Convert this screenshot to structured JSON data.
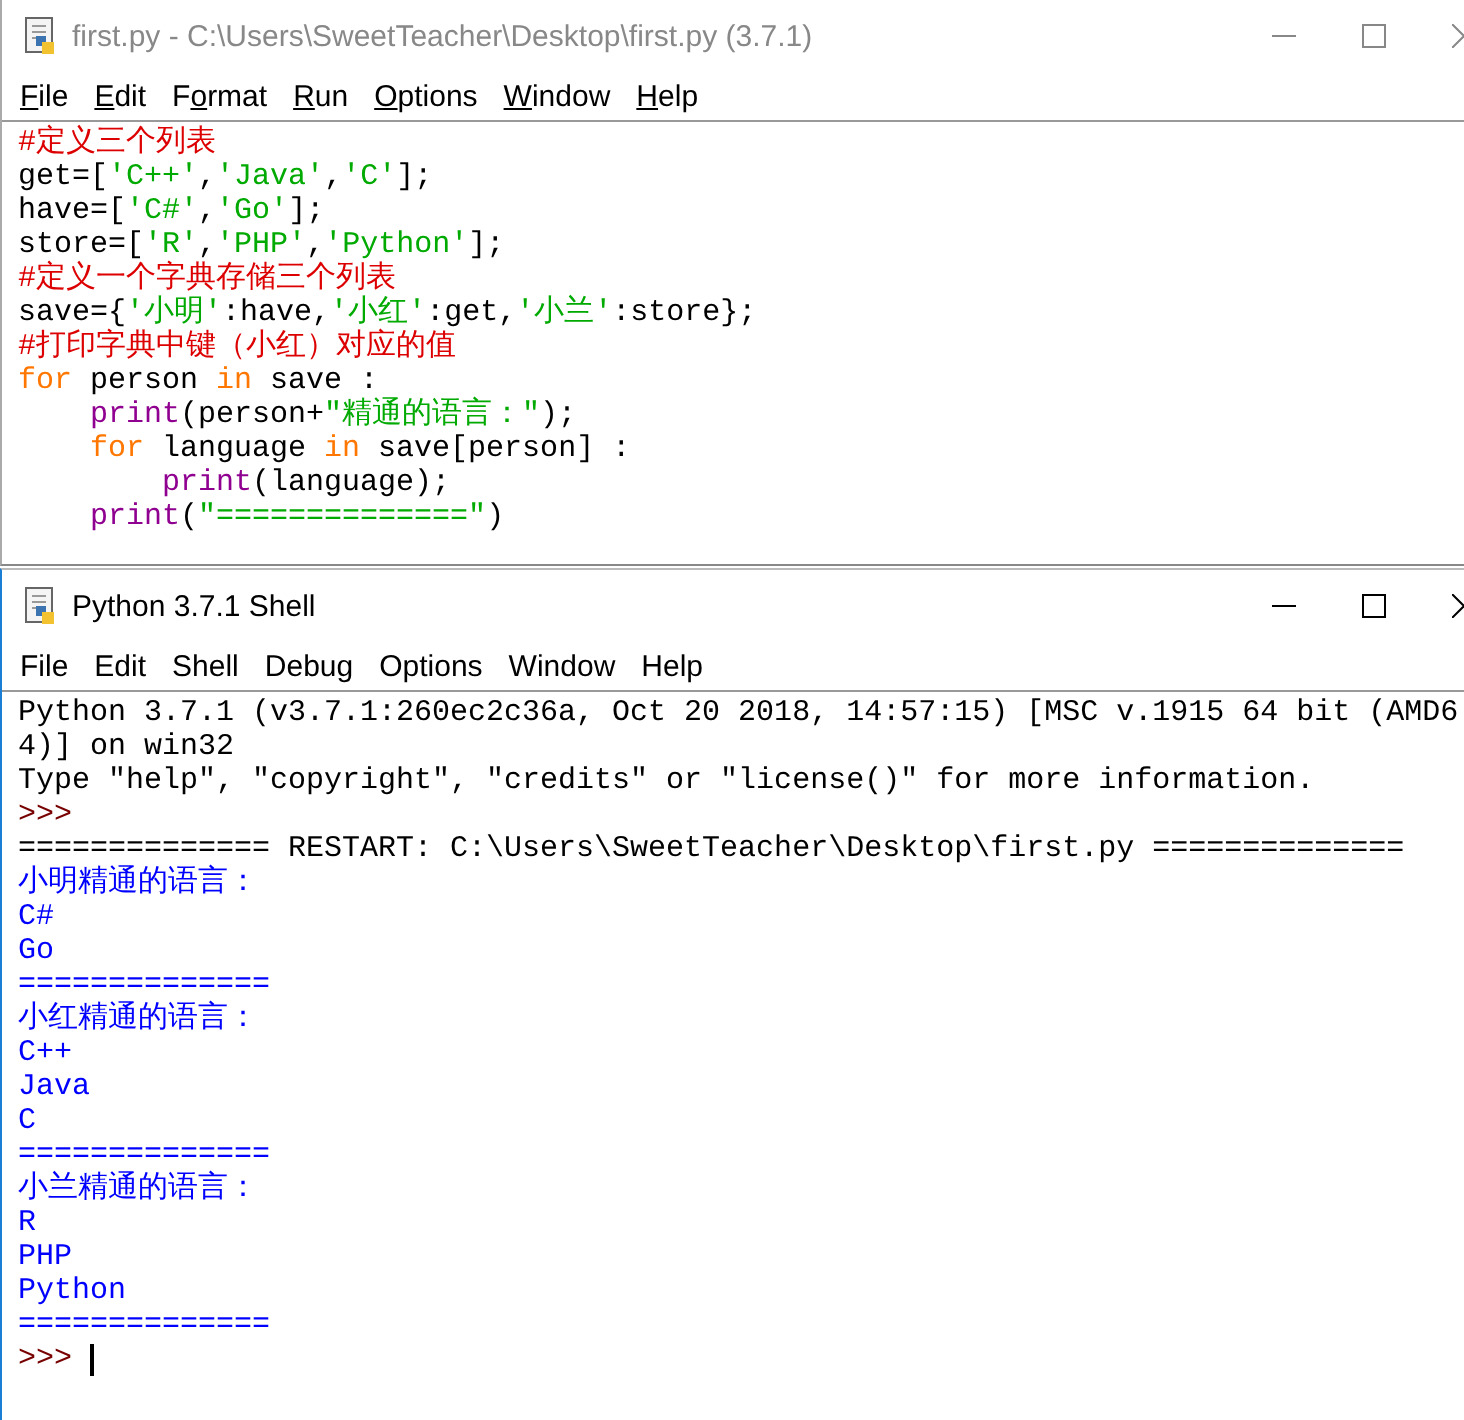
{
  "editor": {
    "title": "first.py - C:\\Users\\SweetTeacher\\Desktop\\first.py (3.7.1)",
    "active": false,
    "menu": [
      {
        "key": "F",
        "after": "ile"
      },
      {
        "key": "E",
        "after": "dit"
      },
      {
        "before": "F",
        "key": "o",
        "after": "rmat"
      },
      {
        "key": "R",
        "after": "un"
      },
      {
        "key": "O",
        "after": "ptions"
      },
      {
        "key": "W",
        "after": "indow"
      },
      {
        "key": "H",
        "after": "elp"
      }
    ],
    "lines": [
      [
        {
          "kind": "comment",
          "text": "#定义三个列表"
        }
      ],
      [
        {
          "kind": "plain",
          "text": "get=["
        },
        {
          "kind": "string",
          "text": "'C++'"
        },
        {
          "kind": "plain",
          "text": ","
        },
        {
          "kind": "string",
          "text": "'Java'"
        },
        {
          "kind": "plain",
          "text": ","
        },
        {
          "kind": "string",
          "text": "'C'"
        },
        {
          "kind": "plain",
          "text": "];"
        }
      ],
      [
        {
          "kind": "plain",
          "text": "have=["
        },
        {
          "kind": "string",
          "text": "'C#'"
        },
        {
          "kind": "plain",
          "text": ","
        },
        {
          "kind": "string",
          "text": "'Go'"
        },
        {
          "kind": "plain",
          "text": "];"
        }
      ],
      [
        {
          "kind": "plain",
          "text": "store=["
        },
        {
          "kind": "string",
          "text": "'R'"
        },
        {
          "kind": "plain",
          "text": ","
        },
        {
          "kind": "string",
          "text": "'PHP'"
        },
        {
          "kind": "plain",
          "text": ","
        },
        {
          "kind": "string",
          "text": "'Python'"
        },
        {
          "kind": "plain",
          "text": "];"
        }
      ],
      [
        {
          "kind": "comment",
          "text": "#定义一个字典存储三个列表"
        }
      ],
      [
        {
          "kind": "plain",
          "text": "save={"
        },
        {
          "kind": "string",
          "text": "'小明'"
        },
        {
          "kind": "plain",
          "text": ":have,"
        },
        {
          "kind": "string",
          "text": "'小红'"
        },
        {
          "kind": "plain",
          "text": ":get,"
        },
        {
          "kind": "string",
          "text": "'小兰'"
        },
        {
          "kind": "plain",
          "text": ":store};"
        }
      ],
      [
        {
          "kind": "comment",
          "text": "#打印字典中键（小红）对应的值"
        }
      ],
      [
        {
          "kind": "keyword",
          "text": "for"
        },
        {
          "kind": "plain",
          "text": " person "
        },
        {
          "kind": "keyword",
          "text": "in"
        },
        {
          "kind": "plain",
          "text": " save :"
        }
      ],
      [
        {
          "kind": "builtin",
          "text": "    print"
        },
        {
          "kind": "plain",
          "text": "(person+"
        },
        {
          "kind": "string",
          "text": "\"精通的语言：\""
        },
        {
          "kind": "plain",
          "text": ");"
        }
      ],
      [
        {
          "kind": "keyword",
          "text": "    for"
        },
        {
          "kind": "plain",
          "text": " language "
        },
        {
          "kind": "keyword",
          "text": "in"
        },
        {
          "kind": "plain",
          "text": " save[person] :"
        }
      ],
      [
        {
          "kind": "builtin",
          "text": "        print"
        },
        {
          "kind": "plain",
          "text": "(language);"
        }
      ],
      [
        {
          "kind": "builtin",
          "text": "    print"
        },
        {
          "kind": "plain",
          "text": "("
        },
        {
          "kind": "string",
          "text": "\"==============\""
        },
        {
          "kind": "plain",
          "text": ")"
        }
      ]
    ]
  },
  "shell": {
    "title": "Python 3.7.1 Shell",
    "active": true,
    "menu": [
      {
        "label": "File"
      },
      {
        "label": "Edit"
      },
      {
        "label": "Shell"
      },
      {
        "label": "Debug"
      },
      {
        "label": "Options"
      },
      {
        "label": "Window"
      },
      {
        "label": "Help"
      }
    ],
    "lines": [
      {
        "kind": "plain",
        "text": "Python 3.7.1 (v3.7.1:260ec2c36a, Oct 20 2018, 14:57:15) [MSC v.1915 64 bit (AMD6"
      },
      {
        "kind": "plain",
        "text": "4)] on win32"
      },
      {
        "kind": "plain",
        "text": "Type \"help\", \"copyright\", \"credits\" or \"license()\" for more information."
      },
      {
        "kind": "prompt",
        "text": ">>>",
        "cursor": false
      },
      {
        "kind": "plain",
        "text": "============== RESTART: C:\\Users\\SweetTeacher\\Desktop\\first.py =============="
      },
      {
        "kind": "stdout",
        "text": "小明精通的语言："
      },
      {
        "kind": "stdout",
        "text": "C#"
      },
      {
        "kind": "stdout",
        "text": "Go"
      },
      {
        "kind": "stdout",
        "text": "=============="
      },
      {
        "kind": "stdout",
        "text": "小红精通的语言："
      },
      {
        "kind": "stdout",
        "text": "C++"
      },
      {
        "kind": "stdout",
        "text": "Java"
      },
      {
        "kind": "stdout",
        "text": "C"
      },
      {
        "kind": "stdout",
        "text": "=============="
      },
      {
        "kind": "stdout",
        "text": "小兰精通的语言："
      },
      {
        "kind": "stdout",
        "text": "R"
      },
      {
        "kind": "stdout",
        "text": "PHP"
      },
      {
        "kind": "stdout",
        "text": "Python"
      },
      {
        "kind": "stdout",
        "text": "=============="
      },
      {
        "kind": "prompt",
        "text": ">>>",
        "cursor": true
      }
    ]
  }
}
